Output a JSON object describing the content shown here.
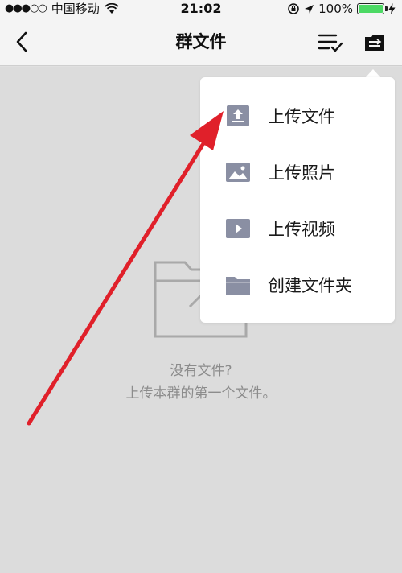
{
  "status_bar": {
    "signal": "●●●○○",
    "carrier": "中国移动",
    "time": "21:02",
    "battery_percent": "100%"
  },
  "nav": {
    "title": "群文件"
  },
  "empty_state": {
    "title": "没有文件?",
    "subtitle": "上传本群的第一个文件。"
  },
  "menu": {
    "items": [
      {
        "label": "上传文件",
        "icon": "upload-icon"
      },
      {
        "label": "上传照片",
        "icon": "image-icon"
      },
      {
        "label": "上传视频",
        "icon": "video-icon"
      },
      {
        "label": "创建文件夹",
        "icon": "folder-icon"
      }
    ]
  },
  "colors": {
    "accent_icon": "#8a8fa3",
    "annotation_arrow": "#e0202a",
    "battery": "#4cd964"
  }
}
